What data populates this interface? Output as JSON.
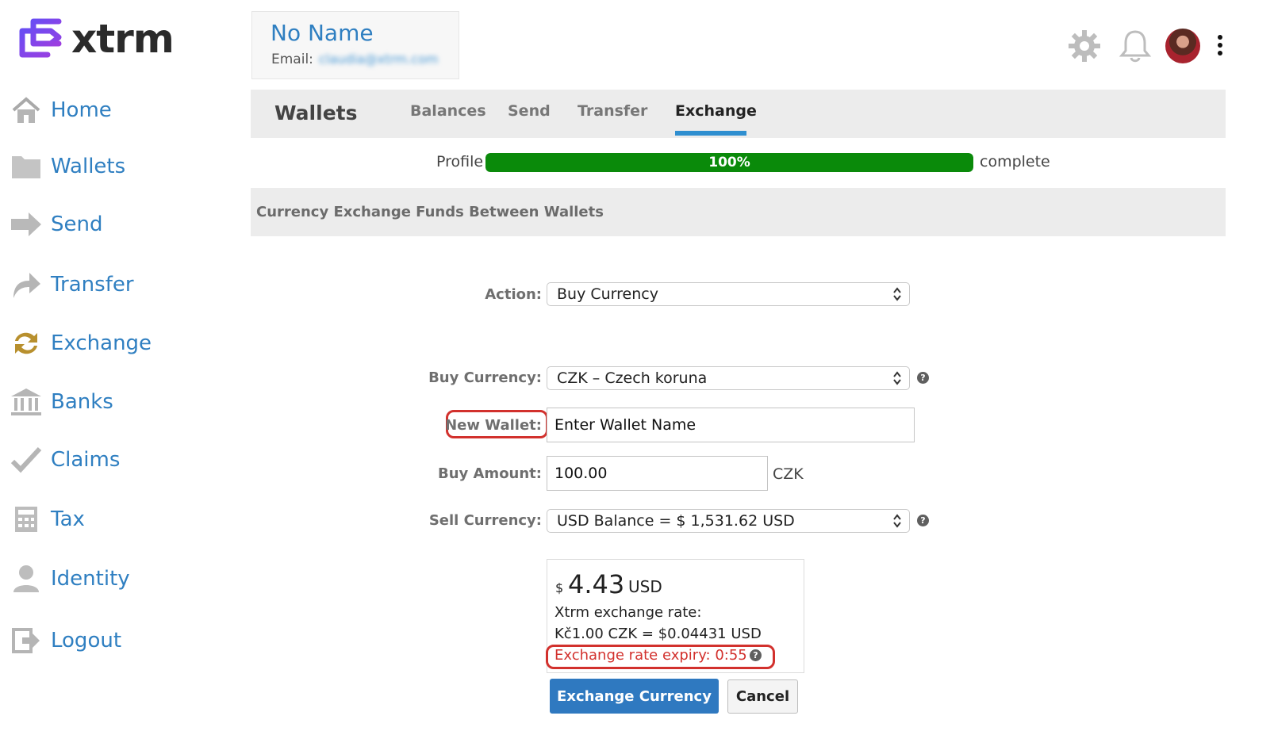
{
  "brand": {
    "name": "xtrm",
    "accent": "#7b3ff2"
  },
  "sidebar": {
    "items": [
      {
        "label": "Home",
        "icon": "home-icon"
      },
      {
        "label": "Wallets",
        "icon": "folder-icon"
      },
      {
        "label": "Send",
        "icon": "arrow-right-icon"
      },
      {
        "label": "Transfer",
        "icon": "transfer-arrow-icon"
      },
      {
        "label": "Exchange",
        "icon": "exchange-icon"
      },
      {
        "label": "Banks",
        "icon": "bank-icon"
      },
      {
        "label": "Claims",
        "icon": "checkmark-icon"
      },
      {
        "label": "Tax",
        "icon": "calculator-icon"
      },
      {
        "label": "Identity",
        "icon": "person-icon"
      },
      {
        "label": "Logout",
        "icon": "logout-icon"
      }
    ]
  },
  "header": {
    "user_name": "No Name",
    "email_label": "Email:",
    "email_value": "claudia@xtrm.com"
  },
  "tabs": {
    "title": "Wallets",
    "items": [
      "Balances",
      "Send",
      "Transfer",
      "Exchange"
    ],
    "active": "Exchange"
  },
  "profile": {
    "label": "Profile",
    "percent": 100,
    "percent_text": "100%",
    "after_text": "complete",
    "fill_color": "#0a8a0a"
  },
  "section": {
    "title": "Currency Exchange Funds Between Wallets"
  },
  "form": {
    "action_label": "Action:",
    "action_value": "Buy Currency",
    "buy_currency_label": "Buy Currency:",
    "buy_currency_value": "CZK – Czech koruna",
    "new_wallet_label": "New Wallet:",
    "new_wallet_value": "Enter Wallet Name",
    "buy_amount_label": "Buy Amount:",
    "buy_amount_value": "100.00",
    "buy_amount_unit": "CZK",
    "sell_currency_label": "Sell Currency:",
    "sell_currency_value": "USD Balance = $ 1,531.62 USD"
  },
  "quote": {
    "symbol": "$",
    "amount": "4.43",
    "currency": "USD",
    "rate_label": "Xtrm exchange rate:",
    "rate_value": "Kč1.00 CZK = $0.04431 USD",
    "expiry": "Exchange rate expiry: 0:55",
    "expiry_color": "#d2312d"
  },
  "buttons": {
    "primary": "Exchange Currency",
    "cancel": "Cancel"
  }
}
